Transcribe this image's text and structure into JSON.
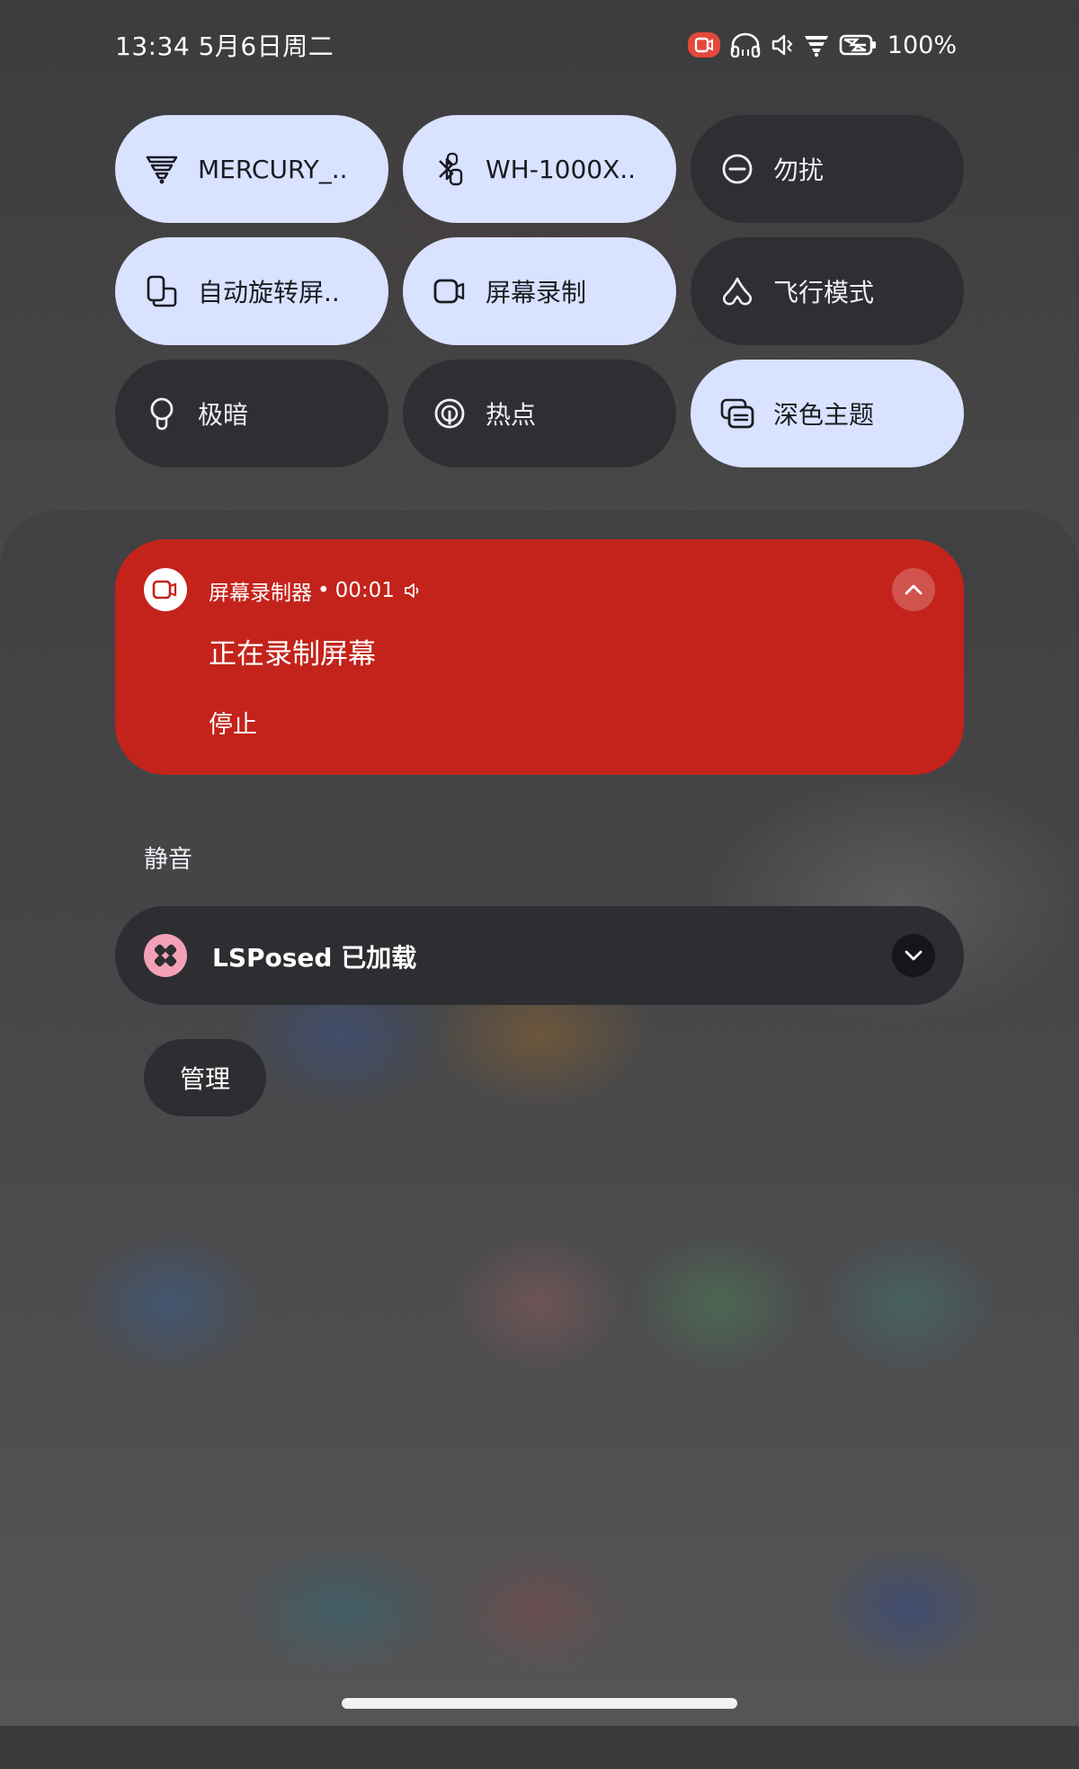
{
  "status_bar": {
    "time": "13:34",
    "date": "5月6日周二",
    "battery": "100%",
    "icons": [
      "screen-recording-icon",
      "headphones-icon",
      "vibrate-icon",
      "wifi-icon",
      "battery-charging-icon"
    ]
  },
  "tiles": [
    {
      "label": "MERCURY_..",
      "icon": "wifi-icon",
      "state": "on"
    },
    {
      "label": "WH-1000X..",
      "icon": "bluetooth-icon",
      "state": "on"
    },
    {
      "label": "勿扰",
      "icon": "do-not-disturb-icon",
      "state": "off"
    },
    {
      "label": "自动旋转屏..",
      "icon": "auto-rotate-icon",
      "state": "on"
    },
    {
      "label": "屏幕录制",
      "icon": "screen-record-icon",
      "state": "on"
    },
    {
      "label": "飞行模式",
      "icon": "airplane-icon",
      "state": "off"
    },
    {
      "label": "极暗",
      "icon": "extra-dim-icon",
      "state": "off"
    },
    {
      "label": "热点",
      "icon": "hotspot-icon",
      "state": "off"
    },
    {
      "label": "深色主题",
      "icon": "dark-theme-icon",
      "state": "on"
    }
  ],
  "recording_notification": {
    "app_name": "屏幕录制器",
    "separator": "•",
    "elapsed": "00:01",
    "title": "正在录制屏幕",
    "action": "停止",
    "color": "#c4231b"
  },
  "section": {
    "silent_label": "静音"
  },
  "lsposed_notification": {
    "title": "LSPosed 已加载"
  },
  "manage_button": {
    "label": "管理"
  }
}
